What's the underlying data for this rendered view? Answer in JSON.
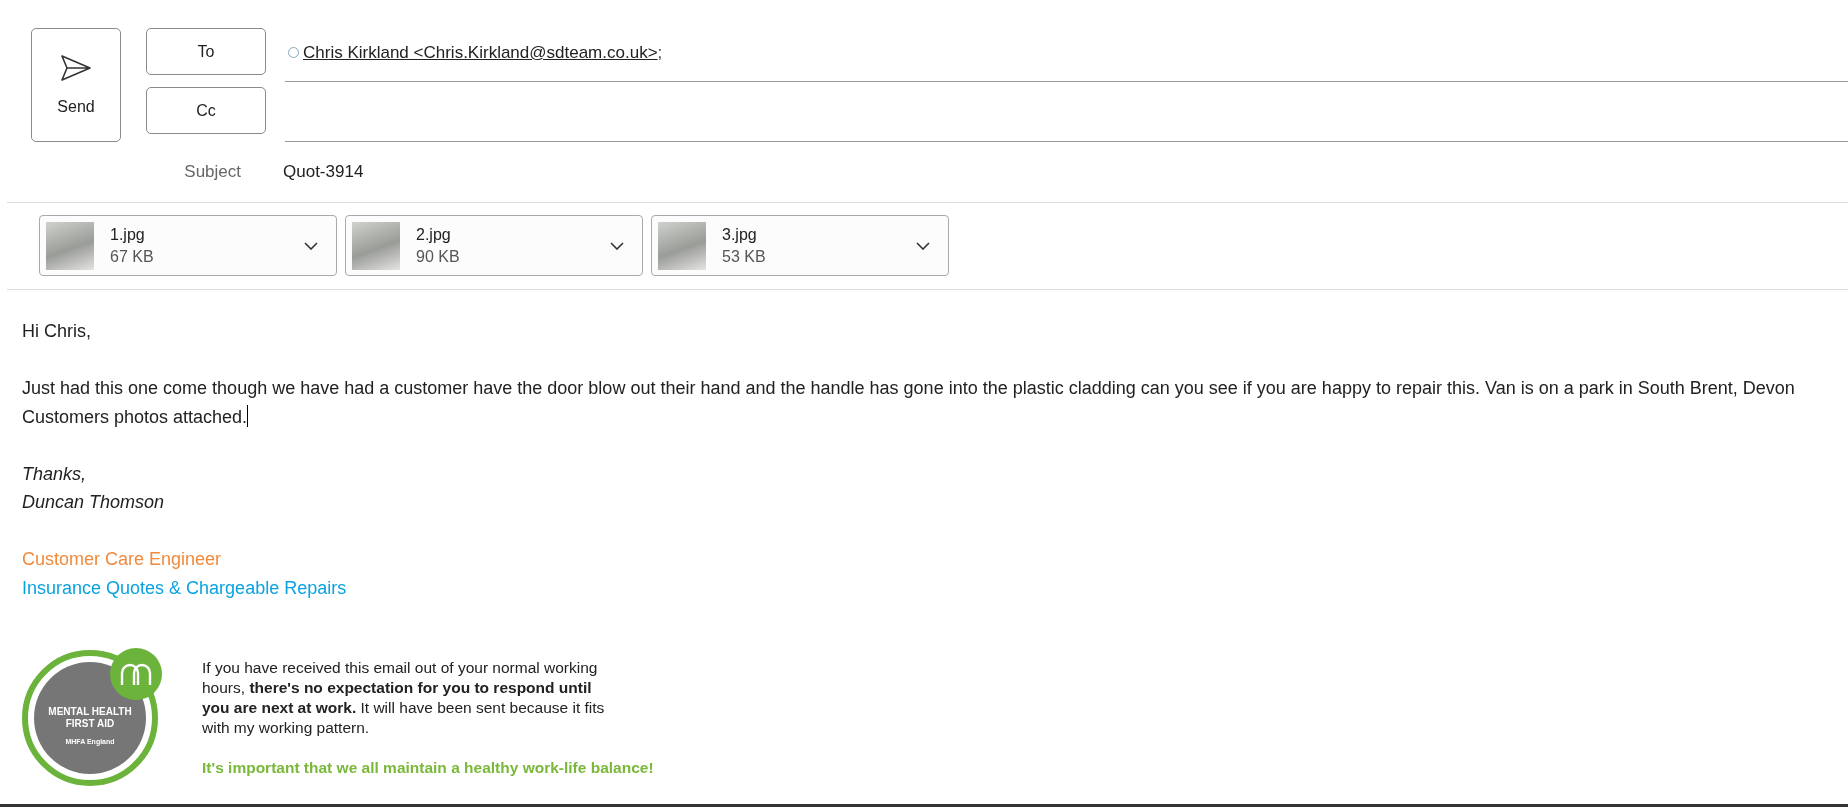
{
  "send_button": {
    "label": "Send"
  },
  "to_button": {
    "label": "To"
  },
  "cc_button": {
    "label": "Cc"
  },
  "recipients": [
    {
      "name": "Chris Kirkland <Chris.Kirkland@sdteam.co.uk>",
      "separator": ";"
    }
  ],
  "subject": {
    "label": "Subject",
    "value": "Quot-3914"
  },
  "attachments": [
    {
      "name": "1.jpg",
      "size": "67 KB"
    },
    {
      "name": "2.jpg",
      "size": "90 KB"
    },
    {
      "name": "3.jpg",
      "size": "53 KB"
    }
  ],
  "body": {
    "greeting": "Hi Chris,",
    "paragraph": "Just had this one come though we have had a customer have the door blow out their hand and the handle has gone into the plastic cladding can you see if you are happy to repair this. Van is on a park in South Brent, Devon",
    "last_line": "Customers photos attached.",
    "signoff": "Thanks,",
    "sender": "Duncan Thomson",
    "job_title": "Customer Care Engineer",
    "department": "Insurance Quotes & Chargeable Repairs"
  },
  "signature": {
    "badge_lines": [
      "MENTAL HEALTH",
      "FIRST AID"
    ],
    "badge_sub": "MHFA England",
    "disclaimer": "If you have received this email out of your normal working hours, **there's no expectation for you to respond until you are next at work.** It will have been sent because it fits with my working pattern.",
    "motto": "It's important that we all maintain a healthy work-life balance!"
  }
}
